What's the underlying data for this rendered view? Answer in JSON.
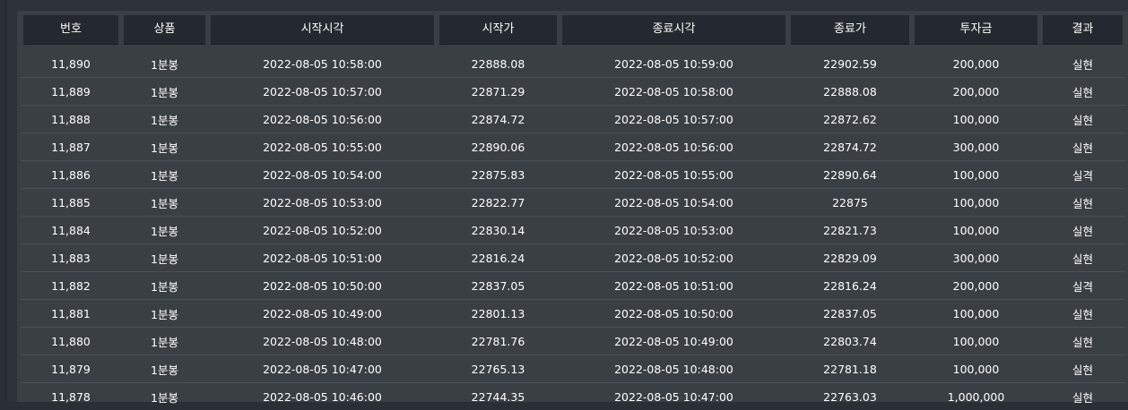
{
  "table": {
    "headers": [
      "번호",
      "상품",
      "시작시각",
      "시작가",
      "종료시각",
      "종료가",
      "투자금",
      "결과"
    ],
    "rows": [
      [
        "11,890",
        "1분봉",
        "2022-08-05 10:58:00",
        "22888.08",
        "2022-08-05 10:59:00",
        "22902.59",
        "200,000",
        "실현"
      ],
      [
        "11,889",
        "1분봉",
        "2022-08-05 10:57:00",
        "22871.29",
        "2022-08-05 10:58:00",
        "22888.08",
        "200,000",
        "실현"
      ],
      [
        "11,888",
        "1분봉",
        "2022-08-05 10:56:00",
        "22874.72",
        "2022-08-05 10:57:00",
        "22872.62",
        "100,000",
        "실현"
      ],
      [
        "11,887",
        "1분봉",
        "2022-08-05 10:55:00",
        "22890.06",
        "2022-08-05 10:56:00",
        "22874.72",
        "300,000",
        "실현"
      ],
      [
        "11,886",
        "1분봉",
        "2022-08-05 10:54:00",
        "22875.83",
        "2022-08-05 10:55:00",
        "22890.64",
        "100,000",
        "실격"
      ],
      [
        "11,885",
        "1분봉",
        "2022-08-05 10:53:00",
        "22822.77",
        "2022-08-05 10:54:00",
        "22875",
        "100,000",
        "실현"
      ],
      [
        "11,884",
        "1분봉",
        "2022-08-05 10:52:00",
        "22830.14",
        "2022-08-05 10:53:00",
        "22821.73",
        "100,000",
        "실현"
      ],
      [
        "11,883",
        "1분봉",
        "2022-08-05 10:51:00",
        "22816.24",
        "2022-08-05 10:52:00",
        "22829.09",
        "300,000",
        "실현"
      ],
      [
        "11,882",
        "1분봉",
        "2022-08-05 10:50:00",
        "22837.05",
        "2022-08-05 10:51:00",
        "22816.24",
        "200,000",
        "실격"
      ],
      [
        "11,881",
        "1분봉",
        "2022-08-05 10:49:00",
        "22801.13",
        "2022-08-05 10:50:00",
        "22837.05",
        "100,000",
        "실현"
      ],
      [
        "11,880",
        "1분봉",
        "2022-08-05 10:48:00",
        "22781.76",
        "2022-08-05 10:49:00",
        "22803.74",
        "100,000",
        "실현"
      ],
      [
        "11,879",
        "1분봉",
        "2022-08-05 10:47:00",
        "22765.13",
        "2022-08-05 10:48:00",
        "22781.18",
        "100,000",
        "실현"
      ],
      [
        "11,878",
        "1분봉",
        "2022-08-05 10:46:00",
        "22744.35",
        "2022-08-05 10:47:00",
        "22763.03",
        "1,000,000",
        "실현"
      ]
    ]
  }
}
